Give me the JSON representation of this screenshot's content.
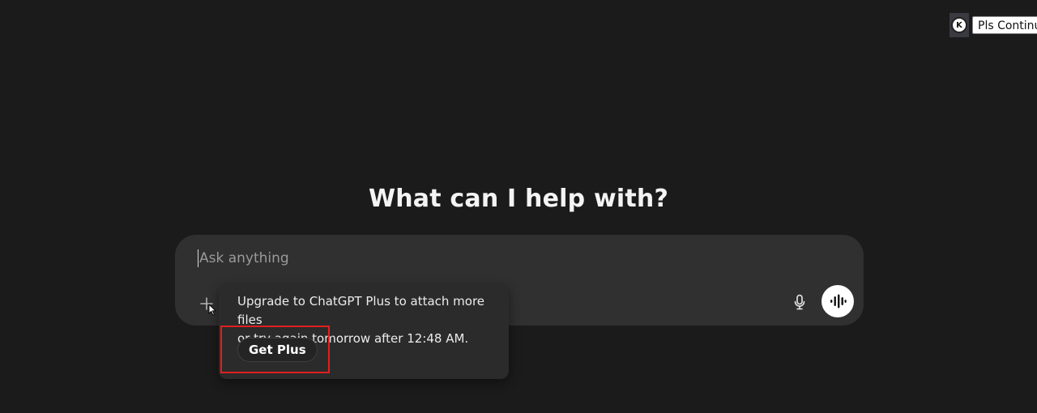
{
  "extension": {
    "icon": "k-circle-icon",
    "icon_letter": "K",
    "button_label": "Pls Continue"
  },
  "headline": "What can I help with?",
  "composer": {
    "placeholder": "Ask anything",
    "value": "",
    "attach_icon": "plus-icon",
    "mic_icon": "microphone-icon",
    "voice_icon": "voice-waveform-icon"
  },
  "popover": {
    "line1": "Upgrade to ChatGPT Plus to attach more files",
    "line2": "or try again tomorrow after 12:48 AM.",
    "button_label": "Get Plus"
  },
  "colors": {
    "background": "#1b1b1b",
    "composer": "#303030",
    "popover": "#2b2b2b",
    "highlight": "#e0201d"
  }
}
